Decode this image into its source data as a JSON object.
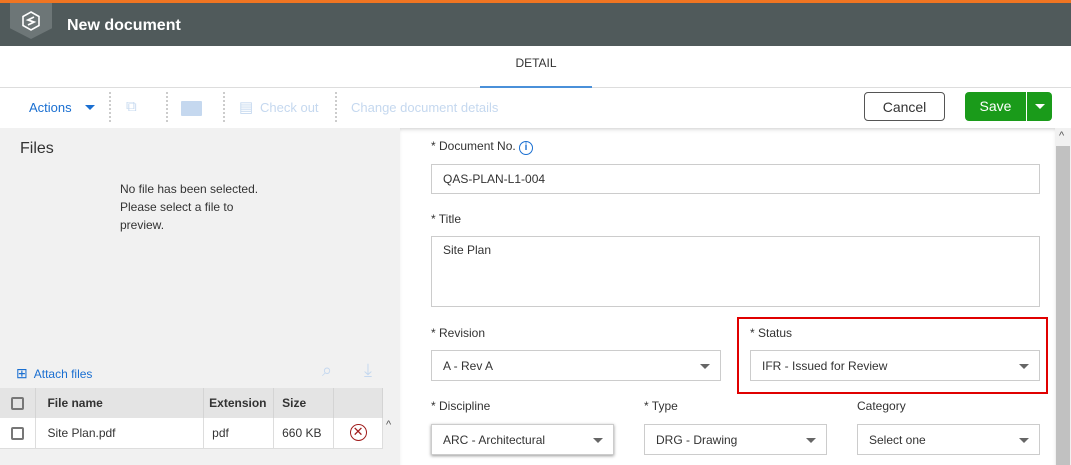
{
  "header": {
    "title": "New document"
  },
  "tabs": [
    {
      "label": "DETAIL"
    }
  ],
  "toolbar": {
    "actions": "Actions",
    "check_out": "Check out",
    "change_details": "Change document details",
    "cancel": "Cancel",
    "save": "Save"
  },
  "files": {
    "heading": "Files",
    "no_file": "No file has been selected. Please select a file to preview.",
    "attach": "Attach files",
    "columns": [
      "File name",
      "Extension",
      "Size"
    ],
    "rows": [
      {
        "name": "Site Plan.pdf",
        "ext": "pdf",
        "size": "660 KB"
      }
    ]
  },
  "form": {
    "doc_no": {
      "label": "* Document No.",
      "value": "QAS-PLAN-L1-004"
    },
    "title": {
      "label": "* Title",
      "value": "Site Plan"
    },
    "revision": {
      "label": "* Revision",
      "value": "A - Rev A"
    },
    "status": {
      "label": "* Status",
      "value": "IFR - Issued for Review"
    },
    "discipline": {
      "label": "* Discipline",
      "value": "ARC - Architectural"
    },
    "type": {
      "label": "* Type",
      "value": "DRG - Drawing"
    },
    "category": {
      "label": "Category",
      "value": "Select one"
    }
  },
  "colors": {
    "accent": "#f07522",
    "header": "#505a5b",
    "save": "#1a9b1a",
    "link": "#1a6fd1",
    "highlight": "#e00000"
  }
}
